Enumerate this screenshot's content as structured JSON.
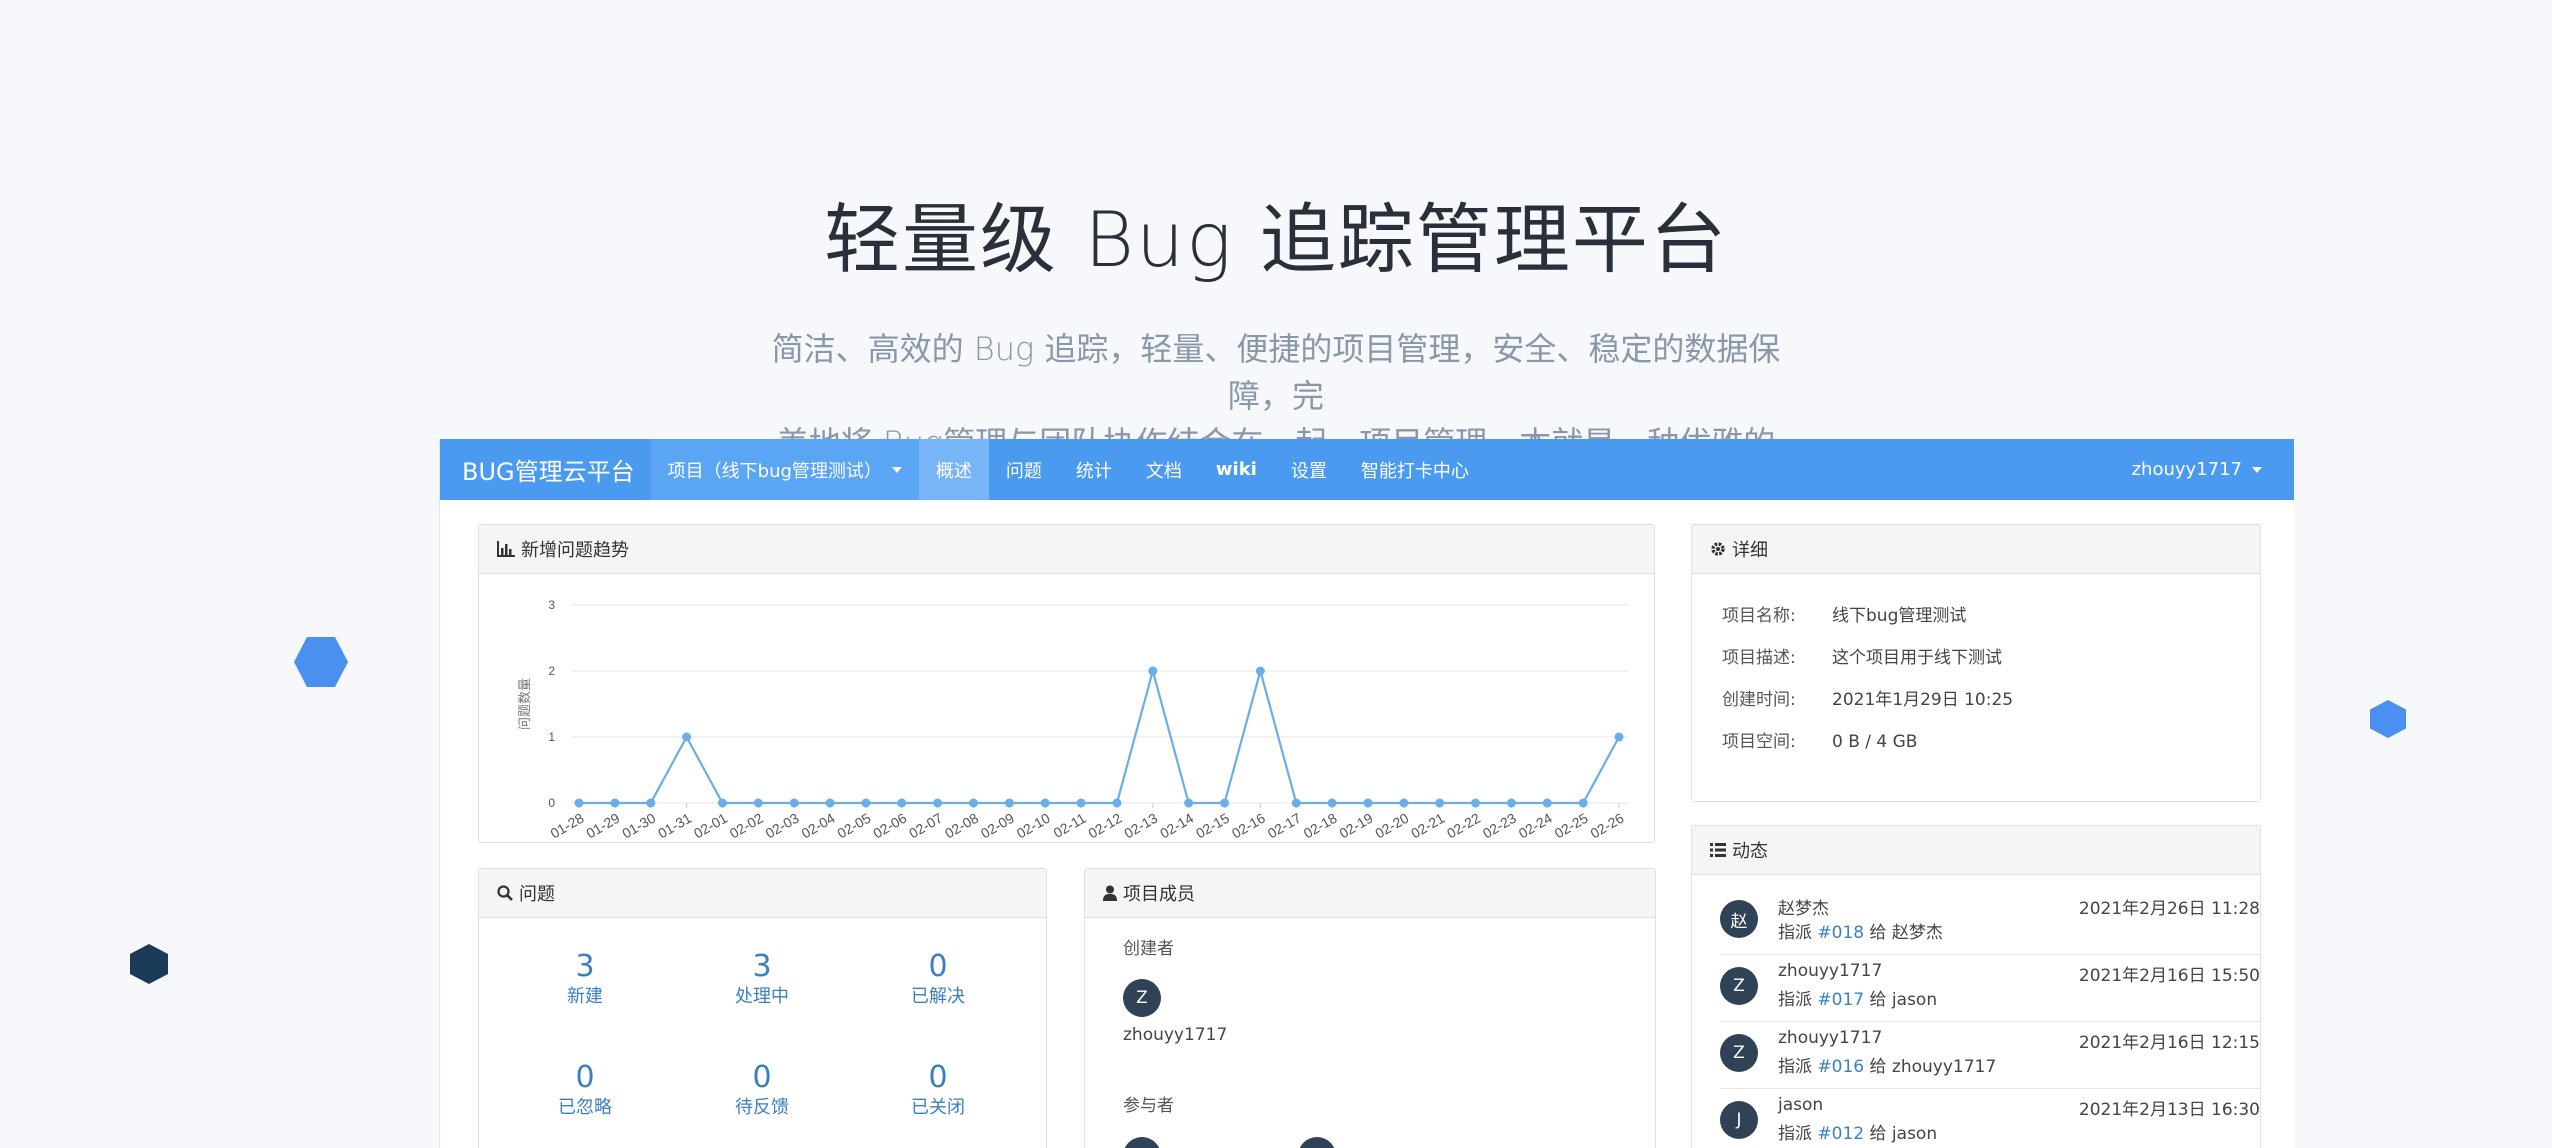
{
  "hero": {
    "title": "轻量级 Bug 追踪管理平台",
    "subtitle_line1": "简洁、高效的 Bug 追踪，轻量、便捷的项目管理，安全、稳定的数据保障，完",
    "subtitle_line2": "美地将 Bug管理与团队协作结合在一起。项目管理，本就是一种优雅的艺术"
  },
  "navbar": {
    "brand": "BUG管理云平台",
    "project_menu": "项目（线下bug管理测试）",
    "items": [
      "概述",
      "问题",
      "统计",
      "文档",
      "wiki",
      "设置",
      "智能打卡中心"
    ],
    "active_item": "概述",
    "user": "zhouyy1717"
  },
  "trend_panel": {
    "title": "新增问题趋势",
    "y_axis_label": "问题数量"
  },
  "chart_data": {
    "type": "line",
    "title": "新增问题趋势",
    "ylabel": "问题数量",
    "ylim": [
      0,
      3
    ],
    "yticks": [
      0,
      1,
      2,
      3
    ],
    "categories": [
      "01-28",
      "01-29",
      "01-30",
      "01-31",
      "02-01",
      "02-02",
      "02-03",
      "02-04",
      "02-05",
      "02-06",
      "02-07",
      "02-08",
      "02-09",
      "02-10",
      "02-11",
      "02-12",
      "02-13",
      "02-14",
      "02-15",
      "02-16",
      "02-17",
      "02-18",
      "02-19",
      "02-20",
      "02-21",
      "02-22",
      "02-23",
      "02-24",
      "02-25",
      "02-26"
    ],
    "values": [
      0,
      0,
      0,
      1,
      0,
      0,
      0,
      0,
      0,
      0,
      0,
      0,
      0,
      0,
      0,
      0,
      2,
      0,
      0,
      2,
      0,
      0,
      0,
      0,
      0,
      0,
      0,
      0,
      0,
      1
    ],
    "line_color": "#6aaee8",
    "grid": true
  },
  "issues_panel": {
    "title": "问题",
    "stats": [
      {
        "num": "3",
        "label": "新建"
      },
      {
        "num": "3",
        "label": "处理中"
      },
      {
        "num": "0",
        "label": "已解决"
      },
      {
        "num": "0",
        "label": "已忽略"
      },
      {
        "num": "0",
        "label": "待反馈"
      },
      {
        "num": "0",
        "label": "已关闭"
      }
    ]
  },
  "members_panel": {
    "title": "项目成员",
    "creator_label": "创建者",
    "creator": {
      "initial": "Z",
      "name": "zhouyy1717"
    },
    "participants_label": "参与者"
  },
  "detail_panel": {
    "title": "详细",
    "rows": [
      {
        "key": "项目名称:",
        "value": "线下bug管理测试"
      },
      {
        "key": "项目描述:",
        "value": "这个项目用于线下测试"
      },
      {
        "key": "创建时间:",
        "value": "2021年1月29日 10:25"
      },
      {
        "key": "项目空间:",
        "value": "0 B / 4 GB"
      }
    ]
  },
  "activity_panel": {
    "title": "动态",
    "items": [
      {
        "initial": "赵",
        "who": "赵梦杰",
        "prefix": "指派",
        "issue": "#018",
        "mid": "给",
        "target": "赵梦杰",
        "time": "2021年2月26日 11:28"
      },
      {
        "initial": "Z",
        "who": "zhouyy1717",
        "prefix": "指派",
        "issue": "#017",
        "mid": "给",
        "target": "jason",
        "time": "2021年2月16日 15:50"
      },
      {
        "initial": "Z",
        "who": "zhouyy1717",
        "prefix": "指派",
        "issue": "#016",
        "mid": "给",
        "target": "zhouyy1717",
        "time": "2021年2月16日 12:15"
      },
      {
        "initial": "J",
        "who": "jason",
        "prefix": "指派",
        "issue": "#012",
        "mid": "给",
        "target": "jason",
        "time": "2021年2月13日 16:30"
      }
    ]
  },
  "colors": {
    "navbar": "#4a9bf0",
    "accent": "#3b7fc4",
    "hex_blue": "#4a90f0",
    "hex_dark": "#1b3a57"
  }
}
